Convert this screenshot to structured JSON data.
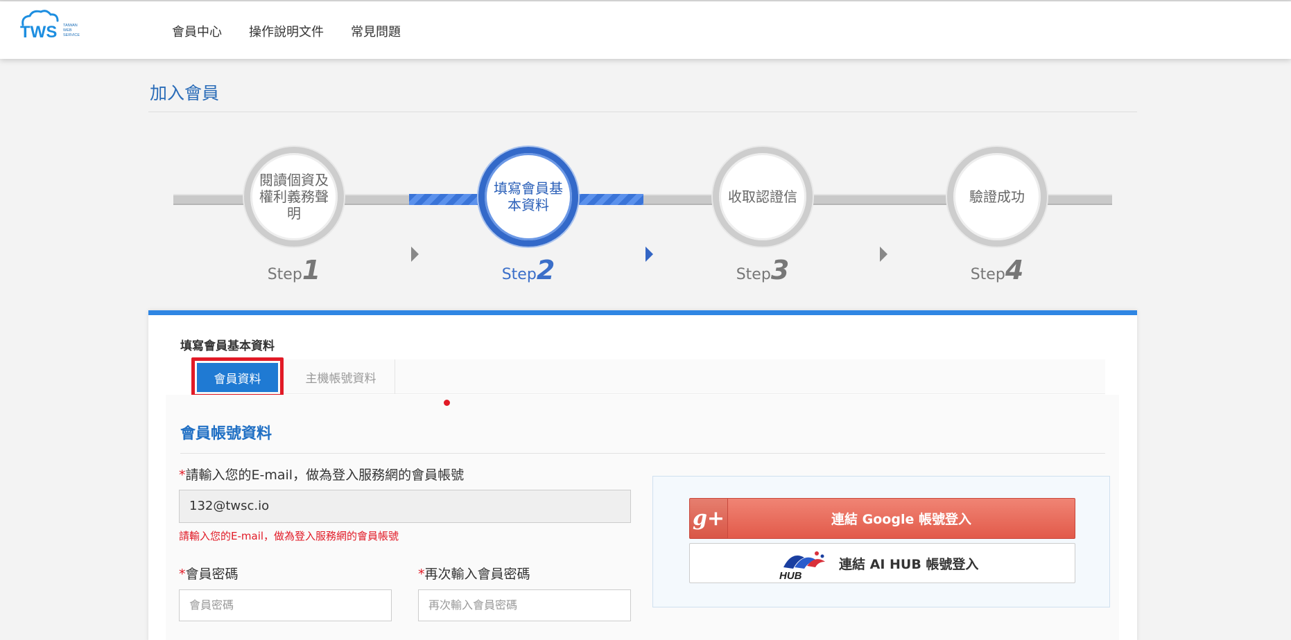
{
  "header": {
    "logo": {
      "text": "TWS",
      "subtext": [
        "TAIWAN",
        "WEB",
        "SERVICE"
      ],
      "icon": "cloud-icon"
    },
    "nav": [
      {
        "label": "會員中心"
      },
      {
        "label": "操作說明文件"
      },
      {
        "label": "常見問題"
      }
    ]
  },
  "page": {
    "title": "加入會員"
  },
  "steps": {
    "items": [
      {
        "circle_text": "閱讀個資及權利義務聲明",
        "label": "Step",
        "number": "1",
        "active": false
      },
      {
        "circle_text": "填寫會員基本資料",
        "label": "Step",
        "number": "2",
        "active": true
      },
      {
        "circle_text": "收取認證信",
        "label": "Step",
        "number": "3",
        "active": false
      },
      {
        "circle_text": "驗證成功",
        "label": "Step",
        "number": "4",
        "active": false
      }
    ],
    "arrow_icon": "triangle-right-icon"
  },
  "form": {
    "panel_title": "填寫會員基本資料",
    "tabs": [
      {
        "label": "會員資料",
        "active": true
      },
      {
        "label": "主機帳號資料",
        "active": false
      }
    ],
    "section_title": "會員帳號資料",
    "required_mark": "*",
    "email": {
      "label": "請輸入您的E-mail，做為登入服務網的會員帳號",
      "value": "132@twsc.io",
      "error": "請輸入您的E-mail，做為登入服務網的會員帳號"
    },
    "password": {
      "label": "會員密碼",
      "placeholder": "會員密碼"
    },
    "password_confirm": {
      "label": "再次輸入會員密碼",
      "placeholder": "再次輸入會員密碼"
    }
  },
  "social": {
    "google": {
      "label": "連結 Google 帳號登入",
      "icon_text": "g+",
      "icon": "google-plus-icon"
    },
    "aihub": {
      "label": "連結 AI HUB 帳號登入",
      "logo_text": "HUB",
      "icon": "aihub-logo-icon"
    }
  },
  "colors": {
    "accent": "#1f7ad3",
    "title_blue": "#2a6cb8",
    "panel_border": "#2f86e3",
    "error_red": "#e11a26",
    "google_red": "#e25a4a",
    "step_active": "#3369c9",
    "step_inactive": "#cdcdcd"
  }
}
